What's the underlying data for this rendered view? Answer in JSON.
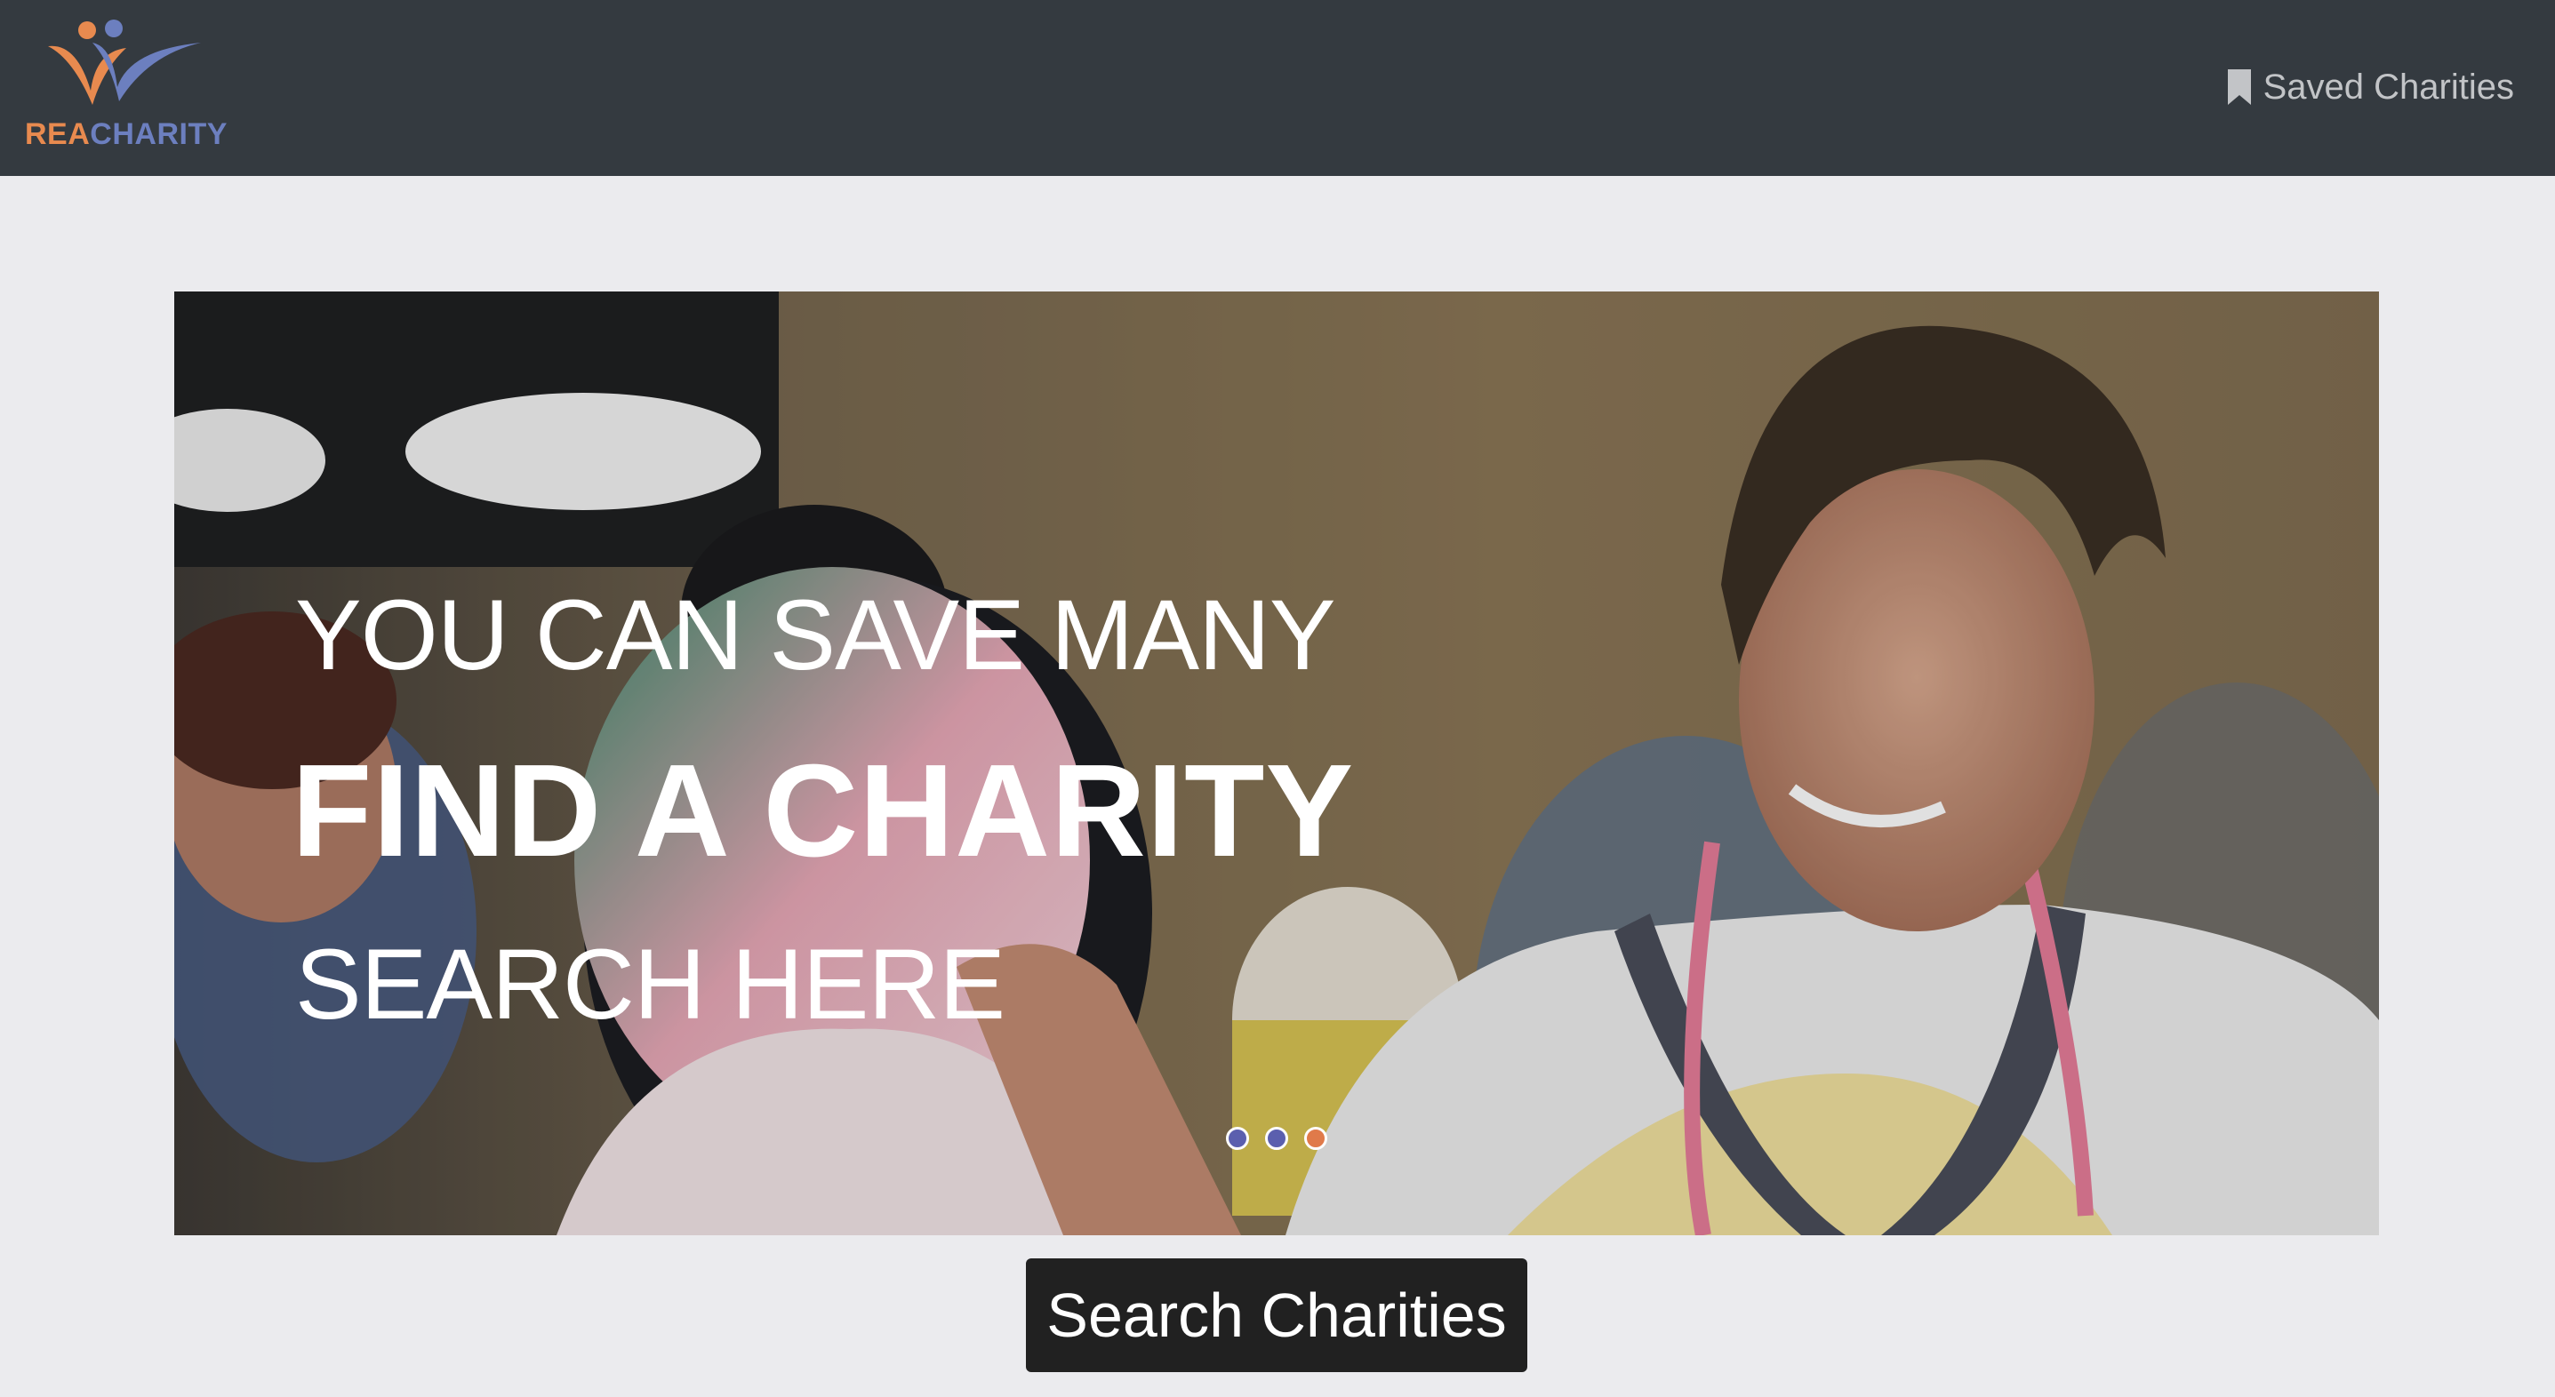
{
  "header": {
    "logo_text_a": "REA",
    "logo_text_b": "CHARITY",
    "saved_link_label": "Saved Charities",
    "saved_icon": "bookmark-icon"
  },
  "carousel": {
    "line1": "YOU CAN SAVE MANY",
    "line2": "FIND A CHARITY",
    "line3": "SEARCH HERE",
    "slide_count": 3,
    "active_index": 2,
    "indicator_colors": [
      "#5b5fae",
      "#5b5fae",
      "#e07a4a"
    ]
  },
  "search_button_label": "Search Charities",
  "colors": {
    "navbar": "#343a40",
    "page_background": "#ebebee",
    "logo_orange": "#e88a4f",
    "logo_blue": "#6c7fbf",
    "button_background": "#212121"
  }
}
